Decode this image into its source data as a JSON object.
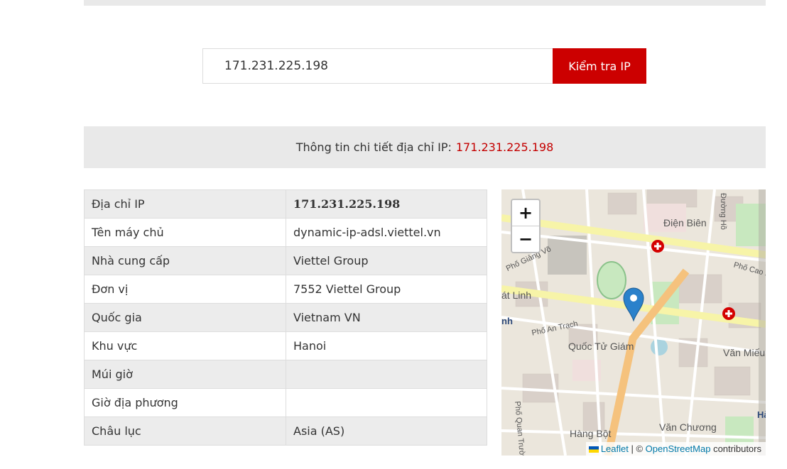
{
  "search": {
    "value": "171.231.225.198",
    "button_label": "Kiểm tra IP"
  },
  "info_bar": {
    "label": "Thông tin chi tiết địa chỉ IP:",
    "ip": "171.231.225.198"
  },
  "details": [
    {
      "key": "Địa chỉ IP",
      "value": "171.231.225.198"
    },
    {
      "key": "Tên máy chủ",
      "value": "dynamic-ip-adsl.viettel.vn"
    },
    {
      "key": "Nhà cung cấp",
      "value": "Viettel Group"
    },
    {
      "key": "Đơn vị",
      "value": "7552 Viettel Group"
    },
    {
      "key": "Quốc gia",
      "value": "Vietnam VN"
    },
    {
      "key": "Khu vực",
      "value": "Hanoi"
    },
    {
      "key": "Múi giờ",
      "value": ""
    },
    {
      "key": "Giờ địa phương",
      "value": ""
    },
    {
      "key": "Châu lục",
      "value": "Asia (AS)"
    }
  ],
  "map": {
    "zoom_in": "+",
    "zoom_out": "−",
    "labels": {
      "dien_bien": "Điện Biên",
      "duong_ho": "Đường Hồ",
      "pho_giang_vo": "Phố Giảng Võ",
      "pho_cao_ba": "Phố Cao Bá",
      "cat_linh": "át Linh",
      "nh": "nh",
      "pho_an_trach": "Phố An Trạch",
      "quoc_tu_giam": "Quốc Tử Giám",
      "van_mieu": "Văn Miếu",
      "quan_truong": "Phố Quan Trường",
      "hang_bot": "Hàng Bột",
      "van_chuong": "Văn Chương",
      "ha": "Hà"
    },
    "attribution": {
      "leaflet": "Leaflet",
      "separator": " | © ",
      "osm": "OpenStreetMap",
      "contributors": " contributors"
    },
    "colors": {
      "background": "#ebe6dc",
      "major_road": "#f7f4a8",
      "primary_road": "#f5c27d",
      "park": "#c8e8bf",
      "marker": "#2a81cb"
    }
  },
  "colors": {
    "accent": "#cc0000",
    "ip_text": "#c40000",
    "panel_bg": "#e9e9e9"
  }
}
